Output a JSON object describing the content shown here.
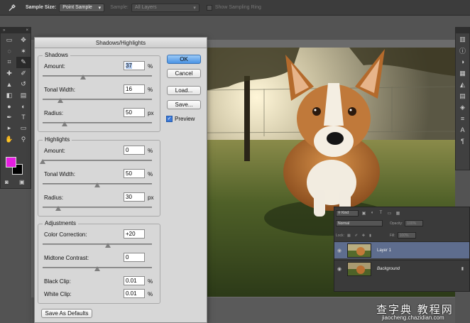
{
  "optionsbar": {
    "tool_icon": "eyedropper-icon",
    "sample_size_label": "Sample Size:",
    "sample_size_value": "Point Sample",
    "sample_label": "Sample:",
    "sample_value": "All Layers",
    "sampling_ring_label": "Show Sampling Ring"
  },
  "dialog": {
    "title": "Shadows/Highlights",
    "shadows": {
      "title": "Shadows",
      "amount_label": "Amount:",
      "amount": "37",
      "amount_unit": "%",
      "amount_level": 0.37,
      "tonal_label": "Tonal Width:",
      "tonal": "16",
      "tonal_unit": "%",
      "tonal_level": 0.16,
      "radius_label": "Radius:",
      "radius": "50",
      "radius_unit": "px",
      "radius_level": 0.2
    },
    "highlights": {
      "title": "Highlights",
      "amount_label": "Amount:",
      "amount": "0",
      "amount_unit": "%",
      "amount_level": 0.0,
      "tonal_label": "Tonal Width:",
      "tonal": "50",
      "tonal_unit": "%",
      "tonal_level": 0.5,
      "radius_label": "Radius:",
      "radius": "30",
      "radius_unit": "px",
      "radius_level": 0.14
    },
    "adjustments": {
      "title": "Adjustments",
      "color_label": "Color Correction:",
      "color": "+20",
      "color_level": 0.6,
      "midtone_label": "Midtone Contrast:",
      "midtone": "0",
      "midtone_level": 0.5,
      "black_label": "Black Clip:",
      "black": "0.01",
      "black_unit": "%",
      "white_label": "White Clip:",
      "white": "0.01",
      "white_unit": "%"
    },
    "buttons": {
      "ok": "OK",
      "cancel": "Cancel",
      "load": "Load...",
      "save": "Save...",
      "save_defaults": "Save As Defaults"
    },
    "preview_label": "Preview",
    "preview_checked": true
  },
  "layers": {
    "kind_label": "Kind",
    "blend_mode": "Normal",
    "opacity_label": "Opacity:",
    "opacity": "100%",
    "lock_label": "Lock:",
    "fill_label": "Fill:",
    "fill": "100%",
    "items": [
      {
        "name": "Layer 1",
        "active": true
      },
      {
        "name": "Background",
        "active": false,
        "locked": true
      }
    ]
  },
  "colors": {
    "foreground": "#e51ee0",
    "background": "#000000",
    "accent": "#4a94e5"
  },
  "watermark": {
    "line1": "查字典 教程网",
    "line2": "jiaocheng.chazidian.com"
  }
}
